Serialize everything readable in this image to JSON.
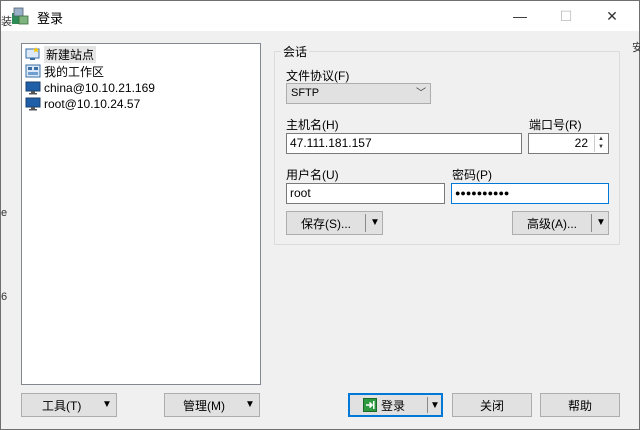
{
  "window": {
    "title": "登录",
    "controls": {
      "minimize": "—",
      "maximize": "☐",
      "close": "✕"
    }
  },
  "background_fragments": [
    "装",
    "安",
    "e",
    "6"
  ],
  "site_tree": {
    "items": [
      {
        "label": "新建站点",
        "icon": "new-site-icon",
        "selected": true
      },
      {
        "label": "我的工作区",
        "icon": "workspace-icon",
        "selected": false
      },
      {
        "label": "china@10.10.21.169",
        "icon": "computer-icon",
        "selected": false
      },
      {
        "label": "root@10.10.24.57",
        "icon": "computer-icon",
        "selected": false
      }
    ]
  },
  "session": {
    "group_title": "会话",
    "protocol_label": "文件协议(F)",
    "protocol_value": "SFTP",
    "host_label": "主机名(H)",
    "host_value": "47.111.181.157",
    "port_label": "端口号(R)",
    "port_value": "22",
    "user_label": "用户名(U)",
    "user_value": "root",
    "password_label": "密码(P)",
    "password_value": "●●●●●●●●●●",
    "save_button": "保存(S)...",
    "advanced_button": "高级(A)..."
  },
  "footer": {
    "tools_button": "工具(T)",
    "manage_button": "管理(M)",
    "login_button": "登录",
    "close_button": "关闭",
    "help_button": "帮助"
  },
  "colors": {
    "accent": "#0078d7",
    "selection": "#e5e5e5"
  }
}
